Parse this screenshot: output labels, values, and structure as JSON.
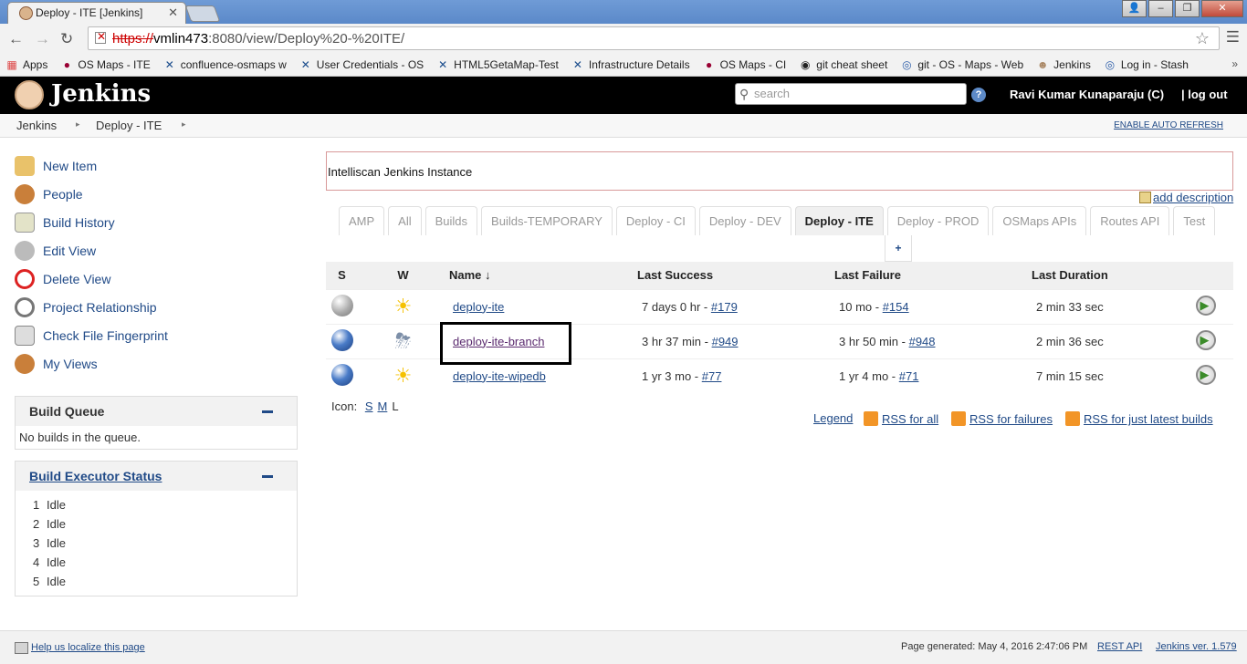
{
  "browser": {
    "tab_title": "Deploy - ITE [Jenkins]",
    "url_scheme": "https://",
    "url_host": "vmlin473",
    "url_path": ":8080/view/Deploy%20-%20ITE/",
    "bookmarks": [
      "Apps",
      "OS Maps - ITE",
      "confluence-osmaps w",
      "User Credentials - OS",
      "HTML5GetaMap-Test",
      "Infrastructure Details",
      "OS Maps - CI",
      "git cheat sheet",
      "git - OS - Maps - Web",
      "Jenkins",
      "Log in - Stash"
    ]
  },
  "header": {
    "title": "Jenkins",
    "search_placeholder": "search",
    "help": "?",
    "user": "Ravi Kumar Kunaparaju (C)",
    "logout": "| log out"
  },
  "breadcrumb": {
    "items": [
      "Jenkins",
      "Deploy - ITE"
    ],
    "auto_refresh": "ENABLE AUTO REFRESH"
  },
  "sidebar": {
    "tasks": [
      "New Item",
      "People",
      "Build History",
      "Edit View",
      "Delete View",
      "Project Relationship",
      "Check File Fingerprint",
      "My Views"
    ],
    "build_queue": {
      "title": "Build Queue",
      "empty": "No builds in the queue."
    },
    "executors": {
      "title": "Build Executor Status",
      "rows": [
        {
          "num": "1",
          "status": "Idle"
        },
        {
          "num": "2",
          "status": "Idle"
        },
        {
          "num": "3",
          "status": "Idle"
        },
        {
          "num": "4",
          "status": "Idle"
        },
        {
          "num": "5",
          "status": "Idle"
        }
      ]
    }
  },
  "main": {
    "description": "Intelliscan Jenkins Instance",
    "add_description": "add description",
    "tabs": [
      "AMP",
      "All",
      "Builds",
      "Builds-TEMPORARY",
      "Deploy - CI",
      "Deploy - DEV",
      "Deploy - ITE",
      "Deploy - PROD",
      "OSMaps APIs",
      "Routes API",
      "Test"
    ],
    "active_tab": "Deploy - ITE",
    "plus_tab": "+",
    "columns": {
      "s": "S",
      "w": "W",
      "name": "Name",
      "sort": "↓",
      "last_success": "Last Success",
      "last_failure": "Last Failure",
      "last_duration": "Last Duration"
    },
    "jobs": [
      {
        "name": "deploy-ite",
        "status": "grey",
        "weather": "sunny",
        "success_time": "7 days 0 hr - ",
        "success_build": "#179",
        "failure_time": "10 mo - ",
        "failure_build": "#154",
        "duration": "2 min 33 sec"
      },
      {
        "name": "deploy-ite-branch",
        "status": "blue",
        "weather": "stormy",
        "success_time": "3 hr 37 min - ",
        "success_build": "#949",
        "failure_time": "3 hr 50 min - ",
        "failure_build": "#948",
        "duration": "2 min 36 sec"
      },
      {
        "name": "deploy-ite-wipedb",
        "status": "blue",
        "weather": "sunny",
        "success_time": "1 yr 3 mo - ",
        "success_build": "#77",
        "failure_time": "1 yr 4 mo - ",
        "failure_build": "#71",
        "duration": "7 min 15 sec"
      }
    ],
    "icon_size": {
      "label": "Icon:",
      "s": "S",
      "m": "M",
      "l": "L"
    },
    "legend": "Legend",
    "rss_all": "RSS for all",
    "rss_failures": "RSS for failures",
    "rss_latest": "RSS for just latest builds"
  },
  "footer": {
    "help_localize": "Help us localize this page",
    "page_generated": "Page generated: May 4, 2016 2:47:06 PM",
    "rest_api": "REST API",
    "version": "Jenkins ver. 1.579"
  }
}
